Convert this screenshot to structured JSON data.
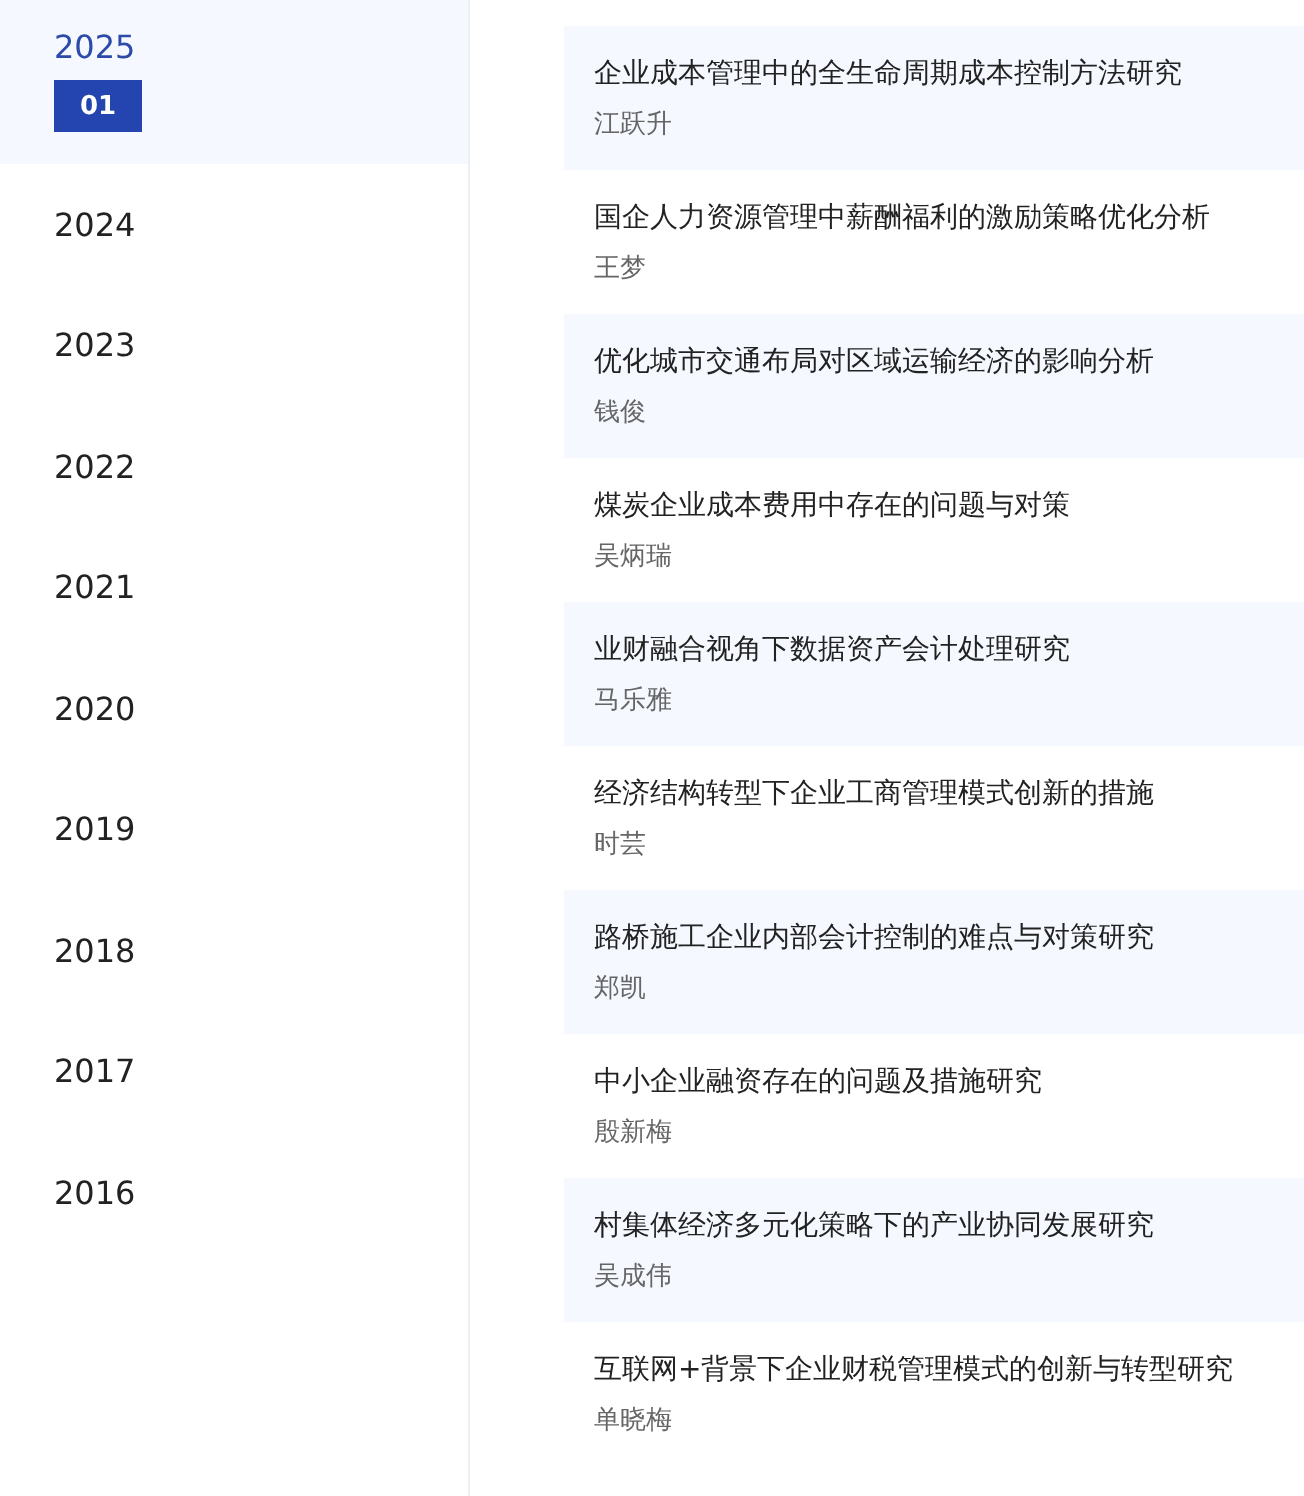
{
  "years": [
    {
      "label": "2025",
      "selected": true,
      "months": [
        {
          "label": "01",
          "selected": true
        }
      ]
    },
    {
      "label": "2024",
      "selected": false
    },
    {
      "label": "2023",
      "selected": false
    },
    {
      "label": "2022",
      "selected": false
    },
    {
      "label": "2021",
      "selected": false
    },
    {
      "label": "2020",
      "selected": false
    },
    {
      "label": "2019",
      "selected": false
    },
    {
      "label": "2018",
      "selected": false
    },
    {
      "label": "2017",
      "selected": false
    },
    {
      "label": "2016",
      "selected": false
    }
  ],
  "articles": [
    {
      "title": "企业成本管理中的全生命周期成本控制方法研究",
      "author": "江跃升"
    },
    {
      "title": "国企人力资源管理中薪酬福利的激励策略优化分析",
      "author": "王梦"
    },
    {
      "title": "优化城市交通布局对区域运输经济的影响分析",
      "author": "钱俊"
    },
    {
      "title": "煤炭企业成本费用中存在的问题与对策",
      "author": "吴炳瑞"
    },
    {
      "title": "业财融合视角下数据资产会计处理研究",
      "author": "马乐雅"
    },
    {
      "title": "经济结构转型下企业工商管理模式创新的措施",
      "author": "时芸"
    },
    {
      "title": "路桥施工企业内部会计控制的难点与对策研究",
      "author": "郑凯"
    },
    {
      "title": "中小企业融资存在的问题及措施研究",
      "author": "殷新梅"
    },
    {
      "title": "村集体经济多元化策略下的产业协同发展研究",
      "author": "吴成伟"
    },
    {
      "title": "互联网+背景下企业财税管理模式的创新与转型研究",
      "author": "单晓梅"
    }
  ]
}
